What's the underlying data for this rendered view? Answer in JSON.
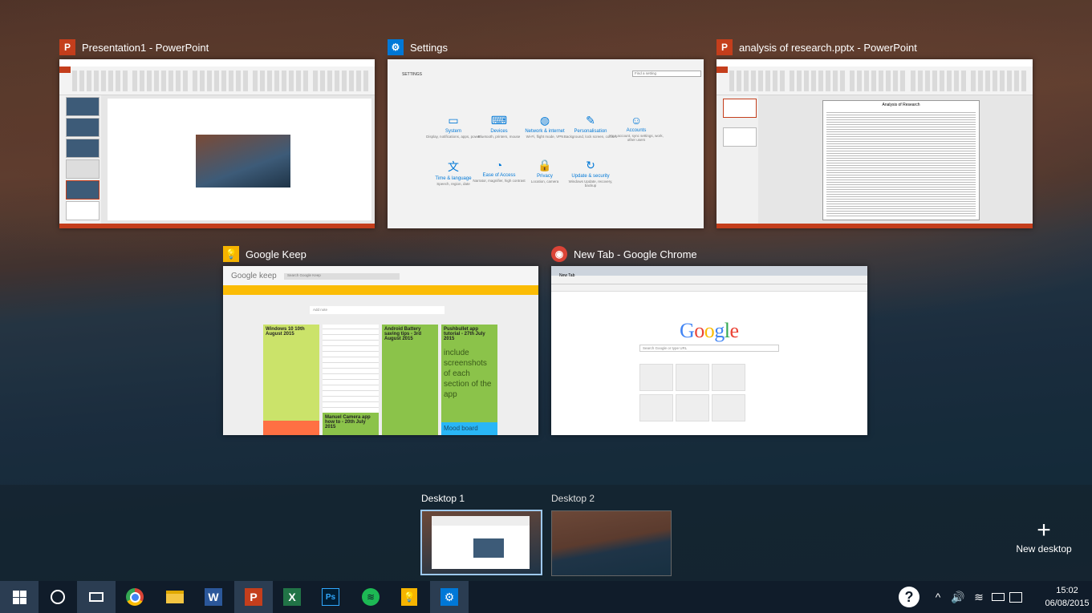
{
  "windows": [
    {
      "title": "Presentation1 - PowerPoint",
      "icon": "powerpoint-icon",
      "icon_glyph": "P",
      "icon_color": "#c43e1c"
    },
    {
      "title": "Settings",
      "icon": "settings-gear-icon",
      "icon_glyph": "⚙",
      "icon_color": "#0078d7",
      "search_placeholder": "Find a setting",
      "heading": "SETTINGS",
      "categories": [
        {
          "name": "System",
          "desc": "Display, notifications, apps, power",
          "glyph": "▭"
        },
        {
          "name": "Devices",
          "desc": "Bluetooth, printers, mouse",
          "glyph": "⌨"
        },
        {
          "name": "Network & internet",
          "desc": "Wi-Fi, flight mode, VPN",
          "glyph": "◍"
        },
        {
          "name": "Personalisation",
          "desc": "Background, lock screen, colours",
          "glyph": "✎"
        },
        {
          "name": "Accounts",
          "desc": "Your account, sync settings, work, other users",
          "glyph": "☺"
        },
        {
          "name": "Time & language",
          "desc": "Speech, region, date",
          "glyph": "文"
        },
        {
          "name": "Ease of Access",
          "desc": "Narrator, magnifier, high contrast",
          "glyph": "◔"
        },
        {
          "name": "Privacy",
          "desc": "Location, camera",
          "glyph": "🔒"
        },
        {
          "name": "Update & security",
          "desc": "Windows Update, recovery, backup",
          "glyph": "↻"
        }
      ]
    },
    {
      "title": "analysis of research.pptx - PowerPoint",
      "icon": "powerpoint-icon",
      "icon_glyph": "P",
      "icon_color": "#c43e1c",
      "slide_heading": "Analysis of Research"
    },
    {
      "title": "Google Keep",
      "icon": "google-keep-icon",
      "icon_glyph": "💡",
      "icon_color": "#f6b400",
      "brand": "Google keep",
      "search_placeholder": "Search Google Keep",
      "add_note_placeholder": "Add note",
      "notes": [
        {
          "title": "Windows 10 10th August 2015",
          "color": "#cbe36a"
        },
        {
          "title": "Android Battery saving tips - 3rd August 2015",
          "color": "#8bc34a"
        },
        {
          "title": "Pushbullet app tutorial - 27th July 2015",
          "color": "#8bc34a",
          "body": "include screenshots of each section of the app"
        },
        {
          "title": "Mood board",
          "color": "#29b6f6"
        },
        {
          "title": "Manuel Camera app how to - 20th July 2015",
          "color": "#8bc34a"
        }
      ]
    },
    {
      "title": "New Tab - Google Chrome",
      "icon": "chrome-icon",
      "icon_glyph": "◉",
      "icon_color": "#db4437",
      "tab_label": "New Tab",
      "search_placeholder": "Search Google or type URL"
    }
  ],
  "desktops": {
    "items": [
      {
        "label": "Desktop 1",
        "active": true
      },
      {
        "label": "Desktop 2",
        "active": false
      }
    ],
    "new_desktop_label": "New desktop"
  },
  "taskbar": {
    "apps": [
      {
        "name": "chrome",
        "glyph": "◉",
        "color": "#db4437"
      },
      {
        "name": "file-explorer",
        "glyph": "▬",
        "color": "#f4c542"
      },
      {
        "name": "word",
        "glyph": "W",
        "color": "#2b579a"
      },
      {
        "name": "powerpoint",
        "glyph": "P",
        "color": "#c43e1c"
      },
      {
        "name": "excel",
        "glyph": "X",
        "color": "#217346"
      },
      {
        "name": "photoshop",
        "glyph": "Ps",
        "color": "#31a8ff"
      },
      {
        "name": "spotify",
        "glyph": "≋",
        "color": "#1db954"
      },
      {
        "name": "google-keep",
        "glyph": "💡",
        "color": "#f6b400"
      },
      {
        "name": "settings",
        "glyph": "⚙",
        "color": "#0078d7"
      }
    ],
    "time": "15:02",
    "date": "06/08/2015"
  }
}
